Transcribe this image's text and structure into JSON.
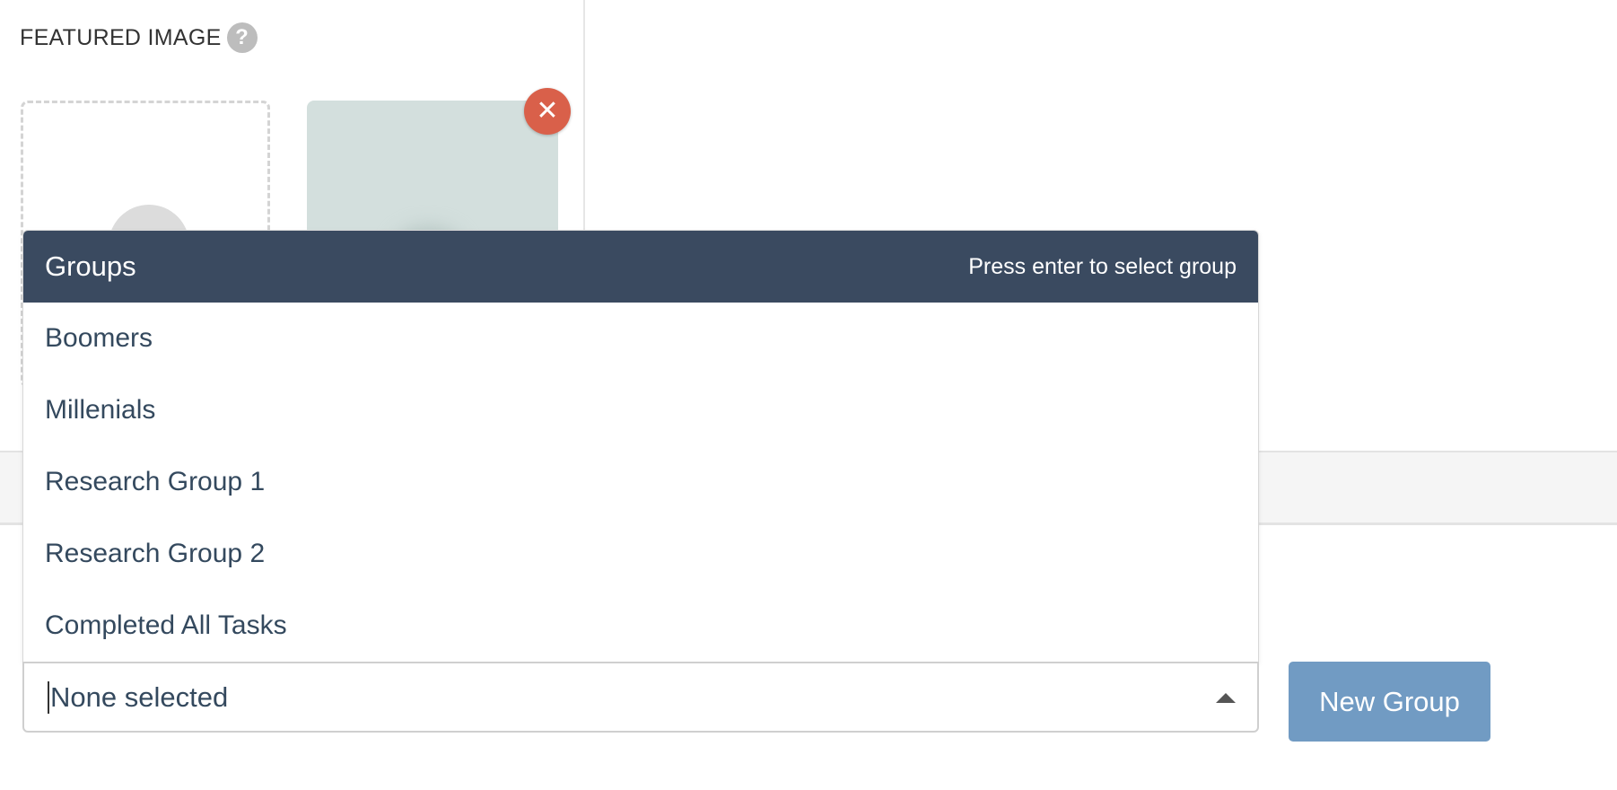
{
  "featured_image": {
    "label": "FEATURED IMAGE",
    "help_glyph": "?",
    "remove_glyph": "✕"
  },
  "groups_dropdown": {
    "title": "Groups",
    "hint": "Press enter to select group",
    "items": [
      {
        "label": "Boomers"
      },
      {
        "label": "Millenials"
      },
      {
        "label": "Research Group 1"
      },
      {
        "label": "Research Group 2"
      },
      {
        "label": "Completed All Tasks"
      }
    ]
  },
  "group_select": {
    "value": "None selected"
  },
  "new_group_button": {
    "label": "New Group"
  },
  "colors": {
    "dropdown_header": "#3a4a60",
    "remove_button": "#d9604a",
    "new_group_button": "#719bc3",
    "text": "#34495e"
  },
  "icons": {
    "help": "help-icon",
    "remove": "close-icon",
    "select_arrow": "caret-up-icon"
  }
}
